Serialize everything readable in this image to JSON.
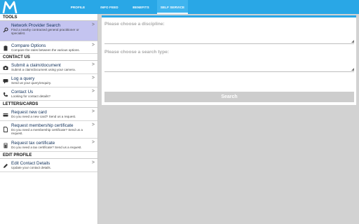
{
  "app": {
    "brand_color": "#29a7e6",
    "logo": "m-logo"
  },
  "tabs": [
    {
      "label": "PROFILE",
      "active": false
    },
    {
      "label": "INFO FEED",
      "active": false
    },
    {
      "label": "BENEFITS",
      "active": false
    },
    {
      "label": "SELF SERVICE",
      "active": true
    }
  ],
  "sidebar": {
    "sections": [
      {
        "title": "TOOLS"
      },
      {
        "title": "CONTACT US"
      },
      {
        "title": "LETTERS/CARDS"
      },
      {
        "title": "EDIT PROFILE"
      }
    ],
    "items": [
      {
        "title": "Network Provider Search",
        "desc": "Find a nearby contracted general practitioner or specialist.",
        "icon": "search-icon",
        "selected": true
      },
      {
        "title": "Compare Options",
        "desc": "Compare the rates between the various options.",
        "icon": "clipboard-icon"
      },
      {
        "title": "Submit a claim/document",
        "desc": "Submit a claim/document using your camera.",
        "icon": "camera-icon"
      },
      {
        "title": "Log a query",
        "desc": "Send us your query/enquiry.",
        "icon": "chat-icon"
      },
      {
        "title": "Contact Us",
        "desc": "Looking for contact details?",
        "icon": "phone-icon"
      },
      {
        "title": "Request new card",
        "desc": "Do you need a new card? Send us a request.",
        "icon": "card-icon"
      },
      {
        "title": "Request membership certificate",
        "desc": "Do you need a membership certificate? Send us a request.",
        "icon": "document-icon"
      },
      {
        "title": "Request tax certificate",
        "desc": "Do you need a tax certificate? Send us a request.",
        "icon": "calculator-icon"
      },
      {
        "title": "Edit Contact Details",
        "desc": "Update your contact details.",
        "icon": "pencil-icon"
      }
    ],
    "chevron": ">"
  },
  "form": {
    "discipline_label": "Please choose a discipline:",
    "search_type_label": "Please choose a search type:",
    "search_button": "Search"
  }
}
